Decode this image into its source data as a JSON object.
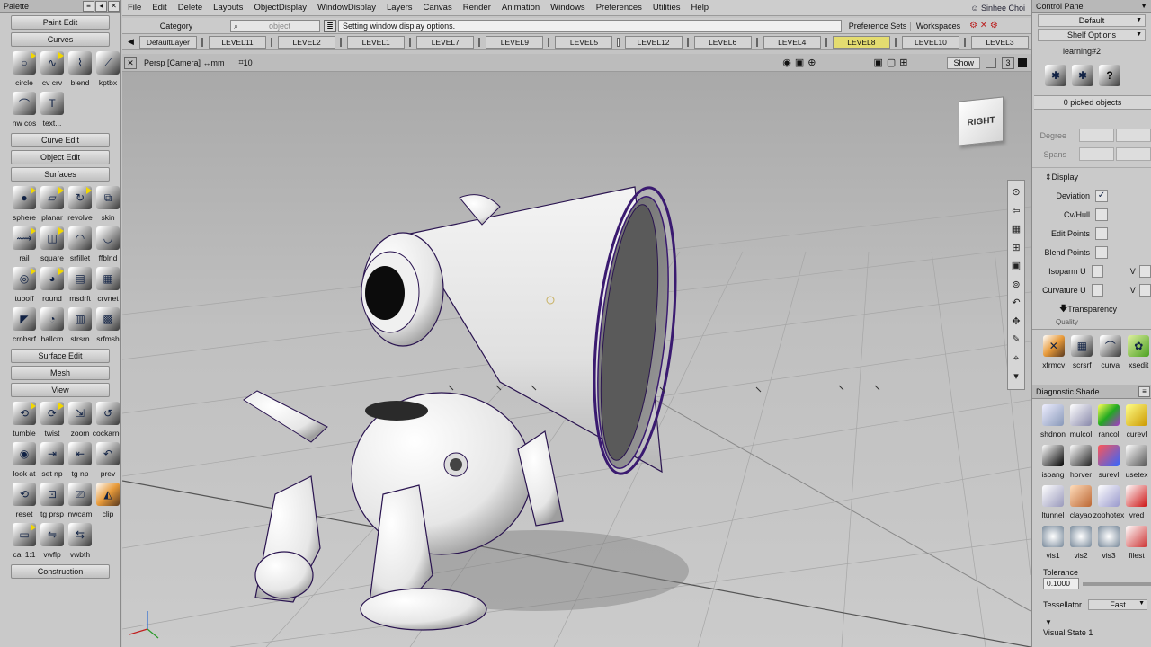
{
  "palette": {
    "title": "Palette",
    "sections": [
      {
        "header": "Paint Edit",
        "tools": []
      },
      {
        "header": "Curves",
        "tools": [
          {
            "label": "circle",
            "icon": "circle-icon"
          },
          {
            "label": "cv crv",
            "icon": "cv-curve-icon"
          },
          {
            "label": "blend",
            "icon": "blend-icon"
          },
          {
            "label": "kptbx",
            "icon": "keypoint-icon"
          },
          {
            "label": "nw cos",
            "icon": "curve-on-surface-icon"
          },
          {
            "label": "text...",
            "icon": "text-icon"
          }
        ]
      },
      {
        "header": "Curve Edit",
        "tools": []
      },
      {
        "header": "Object Edit",
        "tools": []
      },
      {
        "header": "Surfaces",
        "tools": [
          {
            "label": "sphere",
            "icon": "sphere-icon"
          },
          {
            "label": "planar",
            "icon": "planar-icon"
          },
          {
            "label": "revolve",
            "icon": "revolve-icon"
          },
          {
            "label": "skin",
            "icon": "skin-icon"
          },
          {
            "label": "rail",
            "icon": "rail-icon"
          },
          {
            "label": "square",
            "icon": "square-icon"
          },
          {
            "label": "srfillet",
            "icon": "surface-fillet-icon"
          },
          {
            "label": "ffblnd",
            "icon": "freeform-blend-icon"
          },
          {
            "label": "tuboff",
            "icon": "tube-offset-icon"
          },
          {
            "label": "round",
            "icon": "round-icon"
          },
          {
            "label": "msdrft",
            "icon": "multi-surface-draft-icon"
          },
          {
            "label": "crvnet",
            "icon": "curve-network-icon"
          },
          {
            "label": "crnbsrf",
            "icon": "corner-blend-icon"
          },
          {
            "label": "ballcrn",
            "icon": "ball-corner-icon"
          },
          {
            "label": "strsrn",
            "icon": "straight-surface-icon"
          },
          {
            "label": "srfmsh",
            "icon": "surface-mesh-icon"
          }
        ]
      },
      {
        "header": "Surface Edit",
        "tools": []
      },
      {
        "header": "Mesh",
        "tools": []
      },
      {
        "header": "View",
        "tools": [
          {
            "label": "tumble",
            "icon": "tumble-icon"
          },
          {
            "label": "twist",
            "icon": "twist-icon"
          },
          {
            "label": "zoom",
            "icon": "zoom-icon"
          },
          {
            "label": "cockarnd",
            "icon": "lookaround-icon"
          },
          {
            "label": "look at",
            "icon": "look-at-icon"
          },
          {
            "label": "set np",
            "icon": "set-near-plane-icon"
          },
          {
            "label": "tg np",
            "icon": "toggle-near-plane-icon"
          },
          {
            "label": "prev",
            "icon": "previous-view-icon"
          },
          {
            "label": "reset",
            "icon": "reset-view-icon"
          },
          {
            "label": "tg prsp",
            "icon": "toggle-perspective-icon"
          },
          {
            "label": "nwcam",
            "icon": "new-camera-icon"
          },
          {
            "label": "clip",
            "icon": "clip-icon"
          },
          {
            "label": "cal 1:1",
            "icon": "calibrate-icon"
          },
          {
            "label": "vwflp",
            "icon": "view-flip-icon"
          },
          {
            "label": "vwbth",
            "icon": "view-both-icon"
          }
        ]
      },
      {
        "header": "Construction",
        "tools": []
      }
    ]
  },
  "menubar": {
    "items": [
      "File",
      "Edit",
      "Delete",
      "Layouts",
      "ObjectDisplay",
      "WindowDisplay",
      "Layers",
      "Canvas",
      "Render",
      "Animation",
      "Windows",
      "Preferences",
      "Utilities",
      "Help"
    ],
    "user": "Sinhee Choi"
  },
  "toolbar2": {
    "category": "Category",
    "object_placeholder": "object",
    "prompt": "Setting window display options.",
    "preference_sets": "Preference Sets",
    "workspaces": "Workspaces"
  },
  "layers": [
    "DefaultLayer",
    "LEVEL11",
    "LEVEL2",
    "LEVEL1",
    "LEVEL7",
    "LEVEL9",
    "LEVEL5",
    "LEVEL12",
    "LEVEL6",
    "LEVEL4",
    "LEVEL8",
    "LEVEL10",
    "LEVEL3"
  ],
  "active_layer": "LEVEL8",
  "viewport": {
    "title": "Persp [Camera] ↔mm",
    "grid": "10",
    "show_label": "Show",
    "count": "3",
    "viewcube": "RIGHT"
  },
  "control_panel": {
    "title": "Control Panel",
    "preset": "Default",
    "shelf_options": "Shelf Options",
    "shelf_name": "learning#2",
    "picked": "0 picked objects",
    "degree_label": "Degree",
    "spans_label": "Spans",
    "display_header": "Display",
    "options": [
      {
        "label": "Deviation",
        "checked": true
      },
      {
        "label": "Cv/Hull",
        "checked": false
      },
      {
        "label": "Edit Points",
        "checked": false
      },
      {
        "label": "Blend Points",
        "checked": false
      },
      {
        "label": "Isoparm U",
        "checked": false
      },
      {
        "label": "Curvature U",
        "checked": false
      }
    ],
    "v_label": "V",
    "transparency": "Transparency",
    "quality": "Quality",
    "shelf_tools": [
      "xfrmcv",
      "scrsrf",
      "curva",
      "xsedit"
    ]
  },
  "diagnostic": {
    "title": "Diagnostic Shade",
    "tools": [
      "shdnon",
      "mulcol",
      "rancol",
      "curevl",
      "isoang",
      "horver",
      "surevl",
      "usetex",
      "ltunnel",
      "clayao",
      "zophotex",
      "vred",
      "vis1",
      "vis2",
      "vis3",
      "filest"
    ],
    "tolerance_label": "Tolerance",
    "tolerance": "0.1000",
    "tessellator_label": "Tessellator",
    "tessellator": "Fast",
    "visual_state": "Visual State 1"
  }
}
